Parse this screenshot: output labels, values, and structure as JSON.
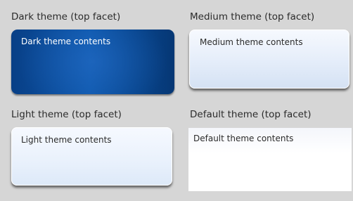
{
  "panels": {
    "dark": {
      "label": "Dark theme (top facet)",
      "contents": "Dark theme contents"
    },
    "medium": {
      "label": "Medium theme (top facet)",
      "contents": "Medium theme contents"
    },
    "light": {
      "label": "Light theme (top facet)",
      "contents": "Light theme contents"
    },
    "default": {
      "label": "Default theme (top facet)",
      "contents": "Default theme contents"
    }
  },
  "colors": {
    "window_background": "#d6d6d6",
    "dark_panel": "#0d58ad",
    "medium_panel": "#d5e2f4",
    "light_panel": "#e9f1fc",
    "default_panel": "#ffffff",
    "label_text": "#2b2b2b"
  }
}
